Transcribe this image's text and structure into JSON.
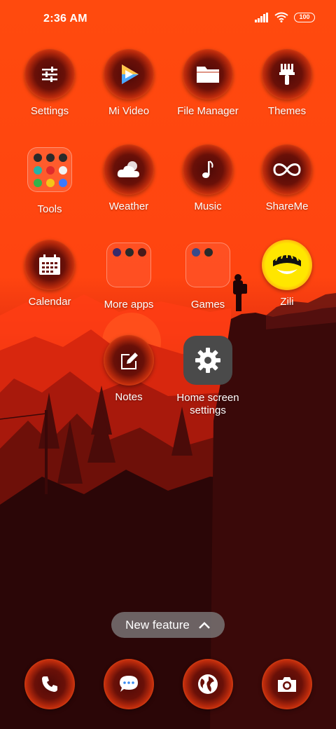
{
  "status_bar": {
    "time": "2:36 AM",
    "battery": "100"
  },
  "apps": [
    {
      "label": "Settings",
      "icon": "sliders-icon"
    },
    {
      "label": "Mi Video",
      "icon": "play-icon"
    },
    {
      "label": "File Manager",
      "icon": "folder-icon"
    },
    {
      "label": "Themes",
      "icon": "brush-icon"
    },
    {
      "label": "Tools",
      "icon": "folder-tools"
    },
    {
      "label": "Weather",
      "icon": "cloud-icon"
    },
    {
      "label": "Music",
      "icon": "music-note-icon"
    },
    {
      "label": "ShareMe",
      "icon": "infinity-icon"
    },
    {
      "label": "Calendar",
      "icon": "calendar-icon"
    },
    {
      "label": "More apps",
      "icon": "folder-more-apps"
    },
    {
      "label": "Games",
      "icon": "folder-games"
    },
    {
      "label": "Zili",
      "icon": "zili-icon"
    },
    {
      "label": "Notes",
      "icon": "edit-icon"
    },
    {
      "label": "Home screen settings",
      "icon": "gear-icon"
    }
  ],
  "new_feature": {
    "label": "New feature"
  },
  "dock": [
    {
      "icon": "phone-icon"
    },
    {
      "icon": "message-icon"
    },
    {
      "icon": "browser-globe-icon"
    },
    {
      "icon": "camera-icon"
    }
  ],
  "colors": {
    "accent": "#ff4a0e",
    "gear_tile": "#4a4a4a",
    "pill": "#7a7373"
  }
}
